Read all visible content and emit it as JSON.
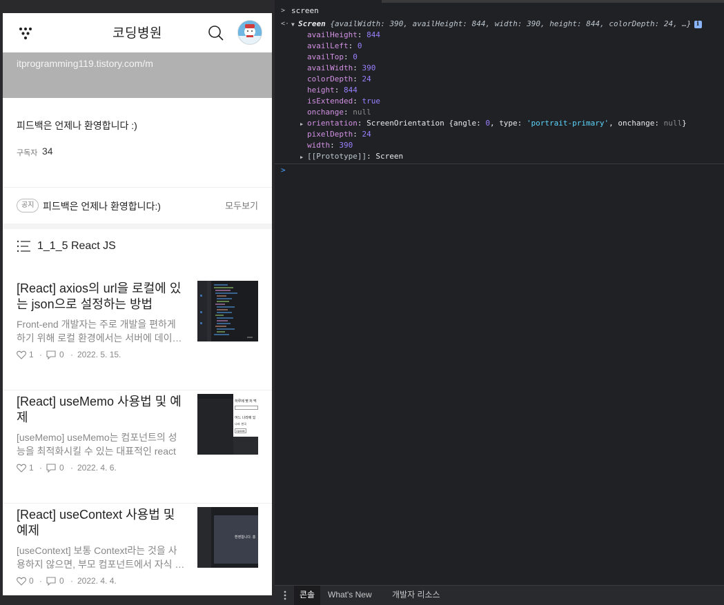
{
  "mobile": {
    "blog_title": "코딩병원",
    "cover_url": "itprogramming119.tistory.com/m",
    "intro_text": "피드백은 언제나 환영합니다 :)",
    "subscriber_label": "구독자",
    "subscriber_count": "34",
    "notice": {
      "badge": "공지",
      "text": "피드백은 언제나 환영합니다:)",
      "more": "모두보기"
    },
    "category_title": "1_1_5 React JS",
    "posts": [
      {
        "title": "[React] axios의 url을 로컬에 있는 json으로 설정하는 방법",
        "excerpt": "Front-end 개발자는 주로 개발을 편하게 하기 위해 로컬 환경에서는 서버에 데이…",
        "likes": "1",
        "comments": "0",
        "date": "2022. 5. 15."
      },
      {
        "title": "[React] useMemo 사용법 및 예제",
        "excerpt": "[useMemo] useMemo는 컴포넌트의 성능을 최적화시킬 수 있는 대표적인 react …",
        "likes": "1",
        "comments": "0",
        "date": "2022. 4. 6."
      },
      {
        "title": "[React] useContext 사용법 및 예제",
        "excerpt": "[useContext] 보통 Context라는 것을 사용하지 않으면, 부모 컴포넌트에서 자식 …",
        "likes": "0",
        "comments": "0",
        "date": "2022. 4. 4."
      }
    ],
    "thumb2_text": [
      "하루에 몇 저 먹",
      "어느 나라에 있",
      "나라: 한국",
      "Update"
    ],
    "thumb3_text": "환영합니다. 홍"
  },
  "devtools": {
    "input_command": "screen",
    "summary": {
      "class_name": "Screen",
      "preview": "{availWidth: 390, availHeight: 844, width: 390, height: 844, colorDepth: 24, …}"
    },
    "properties": [
      {
        "key": "availHeight",
        "value": "844",
        "type": "num"
      },
      {
        "key": "availLeft",
        "value": "0",
        "type": "num"
      },
      {
        "key": "availTop",
        "value": "0",
        "type": "num"
      },
      {
        "key": "availWidth",
        "value": "390",
        "type": "num"
      },
      {
        "key": "colorDepth",
        "value": "24",
        "type": "num"
      },
      {
        "key": "height",
        "value": "844",
        "type": "num"
      },
      {
        "key": "isExtended",
        "value": "true",
        "type": "bool"
      },
      {
        "key": "onchange",
        "value": "null",
        "type": "null"
      }
    ],
    "orientation": {
      "key": "orientation",
      "class_name": "ScreenOrientation",
      "angle": "0",
      "type_value": "'portrait-primary'",
      "onchange": "null"
    },
    "properties_after": [
      {
        "key": "pixelDepth",
        "value": "24",
        "type": "num"
      },
      {
        "key": "width",
        "value": "390",
        "type": "num"
      }
    ],
    "prototype": {
      "key": "[[Prototype]]",
      "value": "Screen"
    },
    "drawer_tabs": [
      {
        "label": "콘솔",
        "active": true
      },
      {
        "label": "What's New",
        "active": false
      },
      {
        "label": "개발자 리소스",
        "active": false
      }
    ]
  },
  "colors": {
    "devtools_bg": "#202124",
    "cover_bg": "#b1b1b1",
    "prop_key": "#d291e4",
    "number": "#9980ff",
    "string": "#5cd5fb"
  }
}
